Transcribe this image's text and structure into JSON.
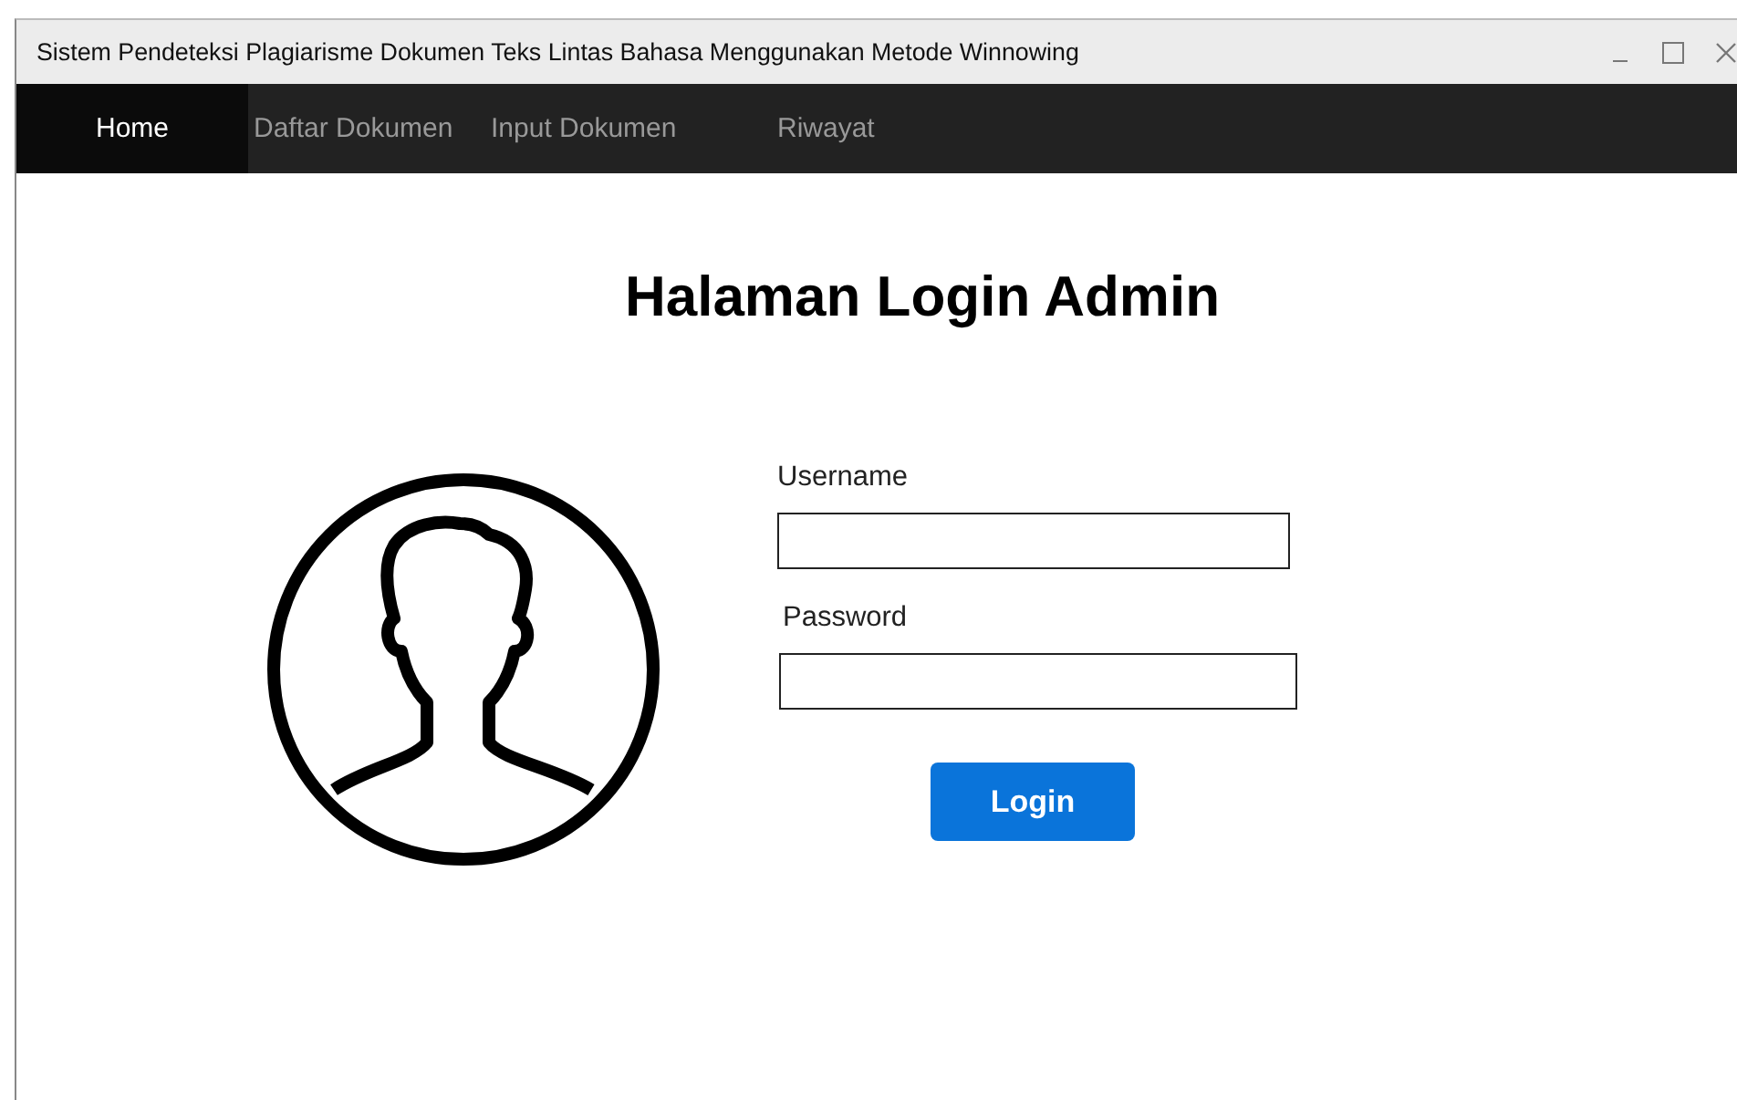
{
  "window": {
    "title": "Sistem Pendeteksi Plagiarisme Dokumen Teks Lintas Bahasa Menggunakan Metode Winnowing"
  },
  "nav": [
    {
      "label": "Home",
      "selected": true
    },
    {
      "label": "Daftar Dokumen",
      "selected": false
    },
    {
      "label": "Input Dokumen",
      "selected": false
    },
    {
      "label": "Riwayat",
      "selected": false
    }
  ],
  "heading": "Halaman Login Admin",
  "fields": [
    {
      "label": "Username"
    },
    {
      "label": "Password"
    }
  ],
  "login_button": "Login"
}
